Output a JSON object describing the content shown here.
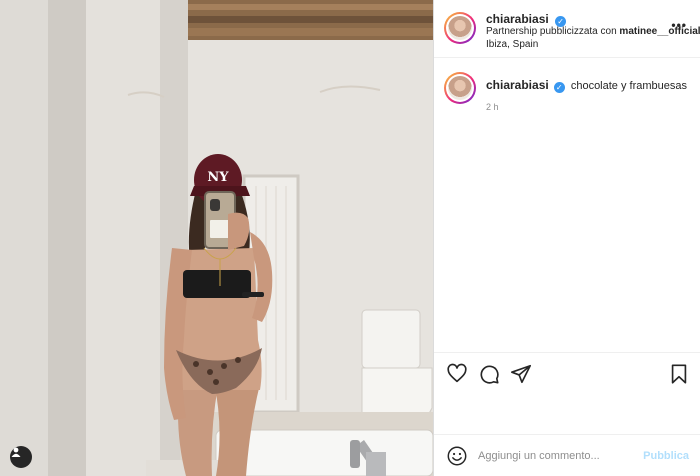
{
  "header": {
    "username": "chiarabiasi",
    "partnership_prefix": "Partnership pubblicizzata con",
    "partner": "matinee__official",
    "location": "Ibiza, Spain",
    "more_icon": "more-options-icon"
  },
  "caption": {
    "username": "chiarabiasi",
    "text": "chocolate y frambuesas",
    "time": "2 h"
  },
  "actions": {
    "icons": [
      "heart-icon",
      "comment-icon",
      "share-icon",
      "bookmark-icon"
    ]
  },
  "comment_box": {
    "placeholder": "Aggiungi un commento...",
    "publish_label": "Pubblica"
  },
  "photo": {
    "cap_logo": "NY"
  },
  "colors": {
    "verified": "#3897f0",
    "publish_disabled": "#b2dffc",
    "muted": "#8e8e8e"
  }
}
